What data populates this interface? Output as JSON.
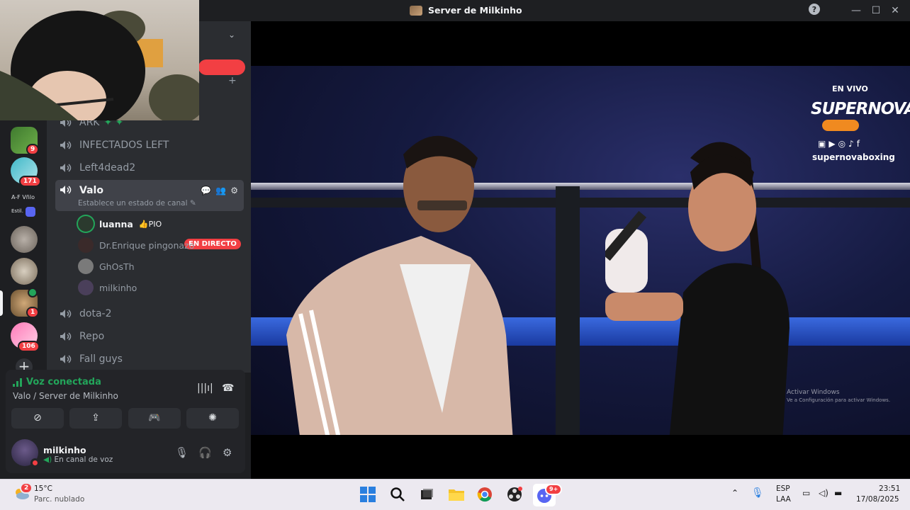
{
  "window": {
    "title": "Server de Milkinho"
  },
  "servers": [
    {
      "name": "server-1",
      "badge": "9"
    },
    {
      "name": "server-2",
      "badge": "171"
    },
    {
      "name": "server-folder",
      "line1": "A-F Vñlo",
      "line2": "Estil."
    },
    {
      "name": "server-4",
      "badge": ""
    },
    {
      "name": "server-5",
      "badge": ""
    },
    {
      "name": "server-6",
      "badge": "1"
    },
    {
      "name": "server-7",
      "badge": "106"
    }
  ],
  "channels": {
    "ark": "ARK",
    "infectados": "INFECTADOS LEFT",
    "left4dead2": "Left4dead2",
    "valo": "Valo",
    "valo_status": "Establece un estado de canal",
    "dota": "dota-2",
    "repo": "Repo",
    "fall": "Fall guys"
  },
  "voice_users": [
    {
      "name": "luanna",
      "tag": "PIO",
      "live": "EN DIRECTO"
    },
    {
      "name": "Dr.Enrique pingonazo"
    },
    {
      "name": "GhOsTh"
    },
    {
      "name": "milkinho"
    }
  ],
  "voice_panel": {
    "status": "Voz conectada",
    "location": "Valo / Server de Milkinho"
  },
  "user": {
    "name": "milkinho",
    "status": "En canal de voz"
  },
  "stream": {
    "live_label": "EN VIVO",
    "brand": "SUPERNOVA",
    "handle": "supernovaboxing",
    "windows_line1": "Activar Windows",
    "windows_line2": "Ve a Configuración para activar Windows."
  },
  "taskbar": {
    "weather_badge": "2",
    "temperature": "15°C",
    "weather": "Parc. nublado",
    "lang1": "ESP",
    "lang2": "LAA",
    "time": "23:51",
    "date": "17/08/2025",
    "discord_badge": "9+"
  },
  "colors": {
    "accent_red": "#f23f43",
    "green": "#23a55a",
    "bg": "#1e1f22",
    "sidebar": "#2b2d31"
  }
}
